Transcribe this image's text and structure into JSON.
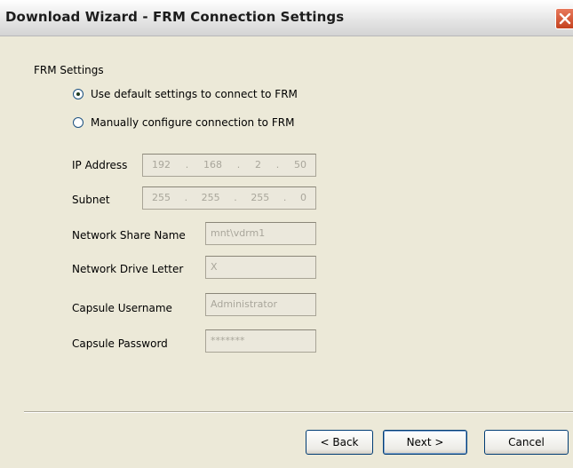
{
  "window": {
    "title": "Download Wizard - FRM Connection Settings"
  },
  "group": {
    "label": "FRM Settings"
  },
  "options": [
    {
      "label": "Use default settings to connect to FRM",
      "selected": true
    },
    {
      "label": "Manually configure connection to FRM",
      "selected": false
    }
  ],
  "fields": {
    "ip_label": "IP Address",
    "ip": [
      "192",
      "168",
      "2",
      "50"
    ],
    "subnet_label": "Subnet",
    "subnet": [
      "255",
      "255",
      "255",
      "0"
    ],
    "share_label": "Network Share Name",
    "share_value": "mnt\\vdrm1",
    "drive_label": "Network Drive Letter",
    "drive_value": "X",
    "user_label": "Capsule Username",
    "user_value": "Administrator",
    "pass_label": "Capsule Password",
    "pass_value": "*******",
    "ip_separator": "."
  },
  "buttons": {
    "back": "< Back",
    "next": "Next >",
    "cancel": "Cancel"
  },
  "colors": {
    "close_button": "#d4542c",
    "background": "#ece9d8",
    "disabled_text": "#a9a69b"
  }
}
